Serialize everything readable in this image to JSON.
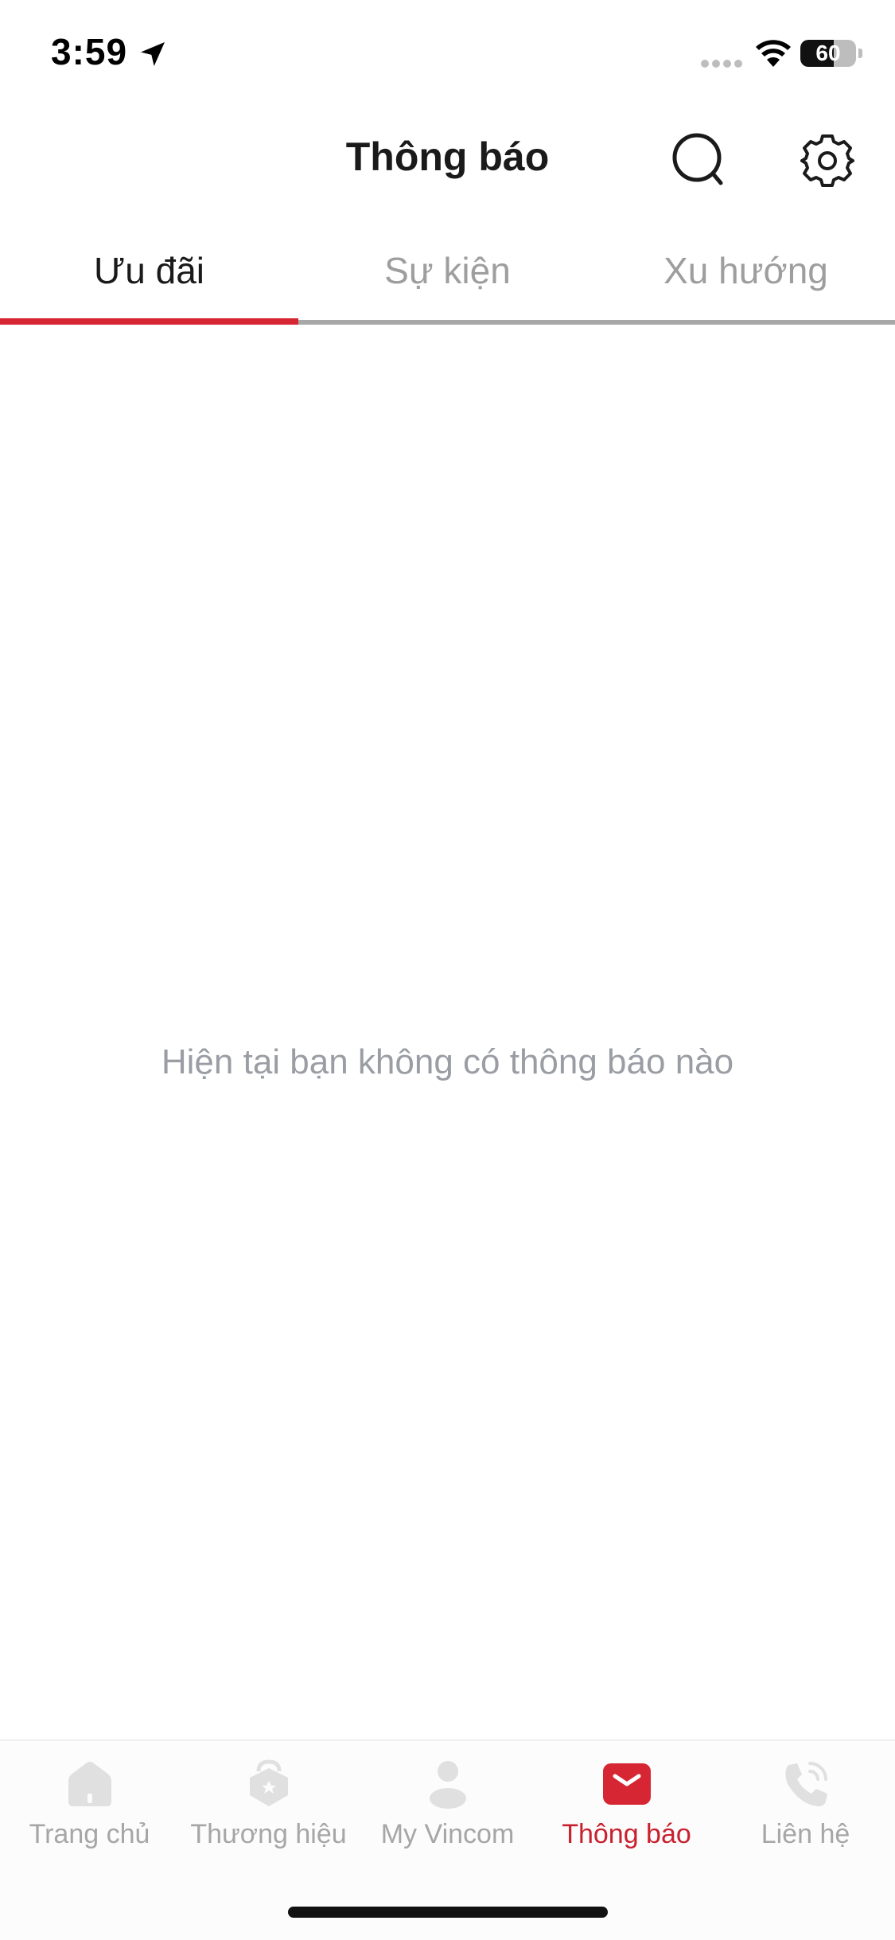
{
  "status_bar": {
    "time": "3:59",
    "battery_level": "60",
    "icons": [
      "location-arrow-icon",
      "signal-icon",
      "wifi-icon",
      "battery-icon"
    ]
  },
  "header": {
    "title": "Thông báo",
    "actions": [
      "search-icon",
      "settings-gear-icon"
    ]
  },
  "tabs": [
    {
      "label": "Ưu đãi",
      "active": true
    },
    {
      "label": "Sự kiện",
      "active": false
    },
    {
      "label": "Xu hướng",
      "active": false
    }
  ],
  "empty_state": {
    "message": "Hiện tại bạn không có thông báo nào"
  },
  "bottom_nav": [
    {
      "label": "Trang chủ",
      "icon": "home-icon",
      "active": false
    },
    {
      "label": "Thương hiệu",
      "icon": "brand-badge-icon",
      "active": false
    },
    {
      "label": "My Vincom",
      "icon": "user-icon",
      "active": false
    },
    {
      "label": "Thông báo",
      "icon": "mail-icon",
      "active": true
    },
    {
      "label": "Liên hệ",
      "icon": "phone-icon",
      "active": false
    }
  ],
  "colors": {
    "accent": "#d62633",
    "active_nav_text": "#c8202e",
    "inactive_text": "#9e9e9e",
    "inactive_icon": "#e0e0e0"
  }
}
